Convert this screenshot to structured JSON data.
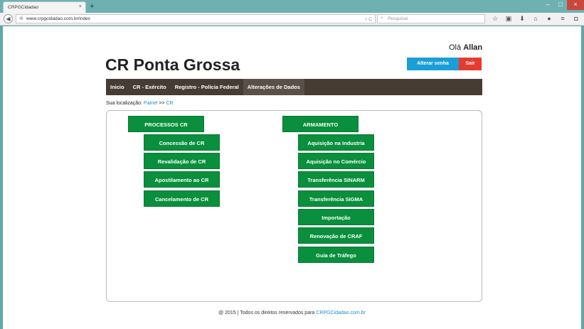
{
  "browser": {
    "tab_title": "CRPGCidadao",
    "tab_close": "×",
    "new_tab": "+",
    "url": "www.crpgcidadao.com.br/index",
    "search_placeholder": "Pesquisar",
    "window_buttons": {
      "minimize": "–",
      "maximize": "□",
      "close": "×"
    }
  },
  "header": {
    "greeting_prefix": "Olá ",
    "user_name": "Allan",
    "site_title": "CR Ponta Grossa",
    "change_password_label": "Alterar senha",
    "logout_label": "Sair"
  },
  "menu": {
    "items": [
      {
        "label": "Inicio"
      },
      {
        "label": "CR - Exército"
      },
      {
        "label": "Registro - Polícia Federal"
      },
      {
        "label": "Alterações de Dados"
      }
    ]
  },
  "breadcrumb": {
    "prefix": "Sua localização: ",
    "root": "Painel",
    "separator": " >> ",
    "current": "CR"
  },
  "processos": {
    "heading": "PROCESSOS CR",
    "items": [
      {
        "label": "Concessão de CR"
      },
      {
        "label": "Revalidação de CR"
      },
      {
        "label": "Apostilamento ao CR"
      },
      {
        "label": "Cancelamento de CR"
      }
    ]
  },
  "armamento": {
    "heading": "ARMAMENTO",
    "items": [
      {
        "label": "Aquisição na Industria"
      },
      {
        "label": "Aquisição no Comércio"
      },
      {
        "label": "Transferência SINARM"
      },
      {
        "label": "Transferência SIGMA"
      },
      {
        "label": "Importação"
      },
      {
        "label": "Renovação de CRAF"
      },
      {
        "label": "Guia de Tráfego"
      }
    ]
  },
  "footer": {
    "text": "@ 2015 | Todos os direitos reservados para ",
    "link": "CRPGCidadao.com.br"
  },
  "colors": {
    "menu_bg": "#473c34",
    "button_green": "#0a8f3c",
    "button_blue": "#1b9ed8",
    "button_red": "#e63a2f",
    "link": "#1b8ed0"
  }
}
